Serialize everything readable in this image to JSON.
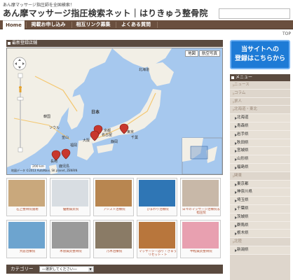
{
  "header": {
    "tagline": "あん摩マッサージ指圧師を全国検索！",
    "title": "あん摩マッサージ指圧検索ネット｜はりきゅう整骨院",
    "search_placeholder": ""
  },
  "nav": {
    "items": [
      {
        "label": "Home",
        "active": true
      },
      {
        "label": "掲載お申し込み",
        "active": false
      },
      {
        "label": "相互リンク募集",
        "active": false
      },
      {
        "label": "よくある質問",
        "active": false
      }
    ]
  },
  "top_link": "TOP",
  "map_panel": {
    "heading": "最新登録店舗",
    "btn_map": "地図",
    "btn_satellite": "航空写真",
    "labels": [
      "北海道",
      "日本",
      "韓国",
      "大阪",
      "京都",
      "名古屋",
      "東京",
      "千葉",
      "ソウル",
      "釜山",
      "長崎",
      "鹿児島",
      "福岡",
      "静岡"
    ],
    "credit": "地図データ ©2013 AutoNavi, SK planet, ZENRIN",
    "scale": "200 km"
  },
  "thumbs": [
    {
      "caption": "石上整骨院施術",
      "color": "#c9a87c"
    },
    {
      "caption": "優癒鍼灸院",
      "color": "#d8dde2"
    },
    {
      "caption": "アシスト治療院",
      "color": "#b88650"
    },
    {
      "caption": "ひまわり治療院",
      "color": "#2f76b5"
    },
    {
      "caption": "日々のマッサージ治療院＆ 指圧院",
      "color": "#c8b8a8"
    },
    {
      "caption": "大庭治療院",
      "color": "#6da4cf"
    },
    {
      "caption": "木曽鍼灸整骨院",
      "color": "#9a9a9a"
    },
    {
      "caption": "乃木治療院",
      "color": "#8a7b66"
    },
    {
      "caption": "マッサージ・はり・きゅうリセット・ト",
      "color": "#b8763c"
    },
    {
      "caption": "中松鍼灸整骨院",
      "color": "#e8a0b0"
    }
  ],
  "category": {
    "label": "カテゴリー",
    "selected": "―選択してください―"
  },
  "register_button": {
    "line1": "当サイトへの",
    "line2": "登録はこちらから"
  },
  "menu": {
    "heading": "メニュー",
    "items": [
      {
        "label": "ニュース",
        "top": true
      },
      {
        "label": "コラム",
        "top": true
      },
      {
        "label": "求人",
        "top": true
      },
      {
        "label": "北海道・東北",
        "top": true
      },
      {
        "label": "北海道",
        "top": false
      },
      {
        "label": "青森県",
        "top": false
      },
      {
        "label": "岩手県",
        "top": false
      },
      {
        "label": "秋田県",
        "top": false
      },
      {
        "label": "宮城県",
        "top": false
      },
      {
        "label": "山形県",
        "top": false
      },
      {
        "label": "福島県",
        "top": false
      },
      {
        "label": "関東",
        "top": true
      },
      {
        "label": "東京都",
        "top": false
      },
      {
        "label": "神奈川県",
        "top": false
      },
      {
        "label": "埼玉県",
        "top": false
      },
      {
        "label": "千葉県",
        "top": false
      },
      {
        "label": "茨城県",
        "top": false
      },
      {
        "label": "群馬県",
        "top": false
      },
      {
        "label": "栃木県",
        "top": false
      },
      {
        "label": "北陸",
        "top": true
      },
      {
        "label": "新潟県",
        "top": false
      }
    ]
  },
  "colors": {
    "nav_bg": "#6a4f3e",
    "accent_blue": "#1e7bd6",
    "map_sea": "#a6c8ee",
    "map_land": "#f2efe6"
  }
}
